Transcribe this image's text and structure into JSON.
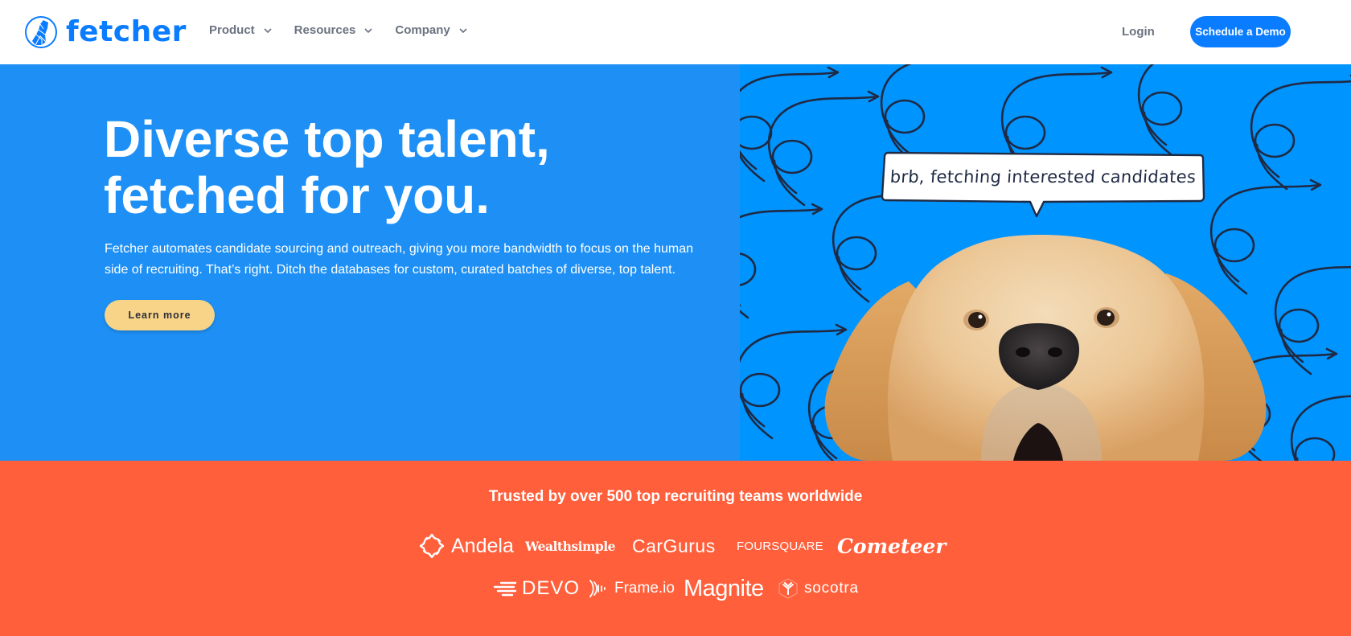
{
  "header": {
    "brand": "fetcher",
    "nav": [
      {
        "label": "Product",
        "icon": "chevron-down-icon"
      },
      {
        "label": "Resources",
        "icon": "chevron-down-icon"
      },
      {
        "label": "Company",
        "icon": "chevron-down-icon"
      }
    ],
    "login_label": "Login",
    "demo_label": "Schedule a Demo"
  },
  "hero": {
    "title_line1": "Diverse top talent,",
    "title_line2": "fetched for you.",
    "description": "Fetcher automates candidate sourcing and outreach, giving you more bandwidth to focus on the human side of recruiting. That’s right. Ditch the databases for custom, curated batches of diverse, top talent.",
    "cta_label": "Learn more",
    "speech_bubble": "brb, fetching interested candidates",
    "image": "golden-retriever-peeking"
  },
  "trusted": {
    "title": "Trusted by over 500 top recruiting teams worldwide",
    "logos_row1": [
      "Andela",
      "Wealthsimple",
      "CarGurus",
      "FOURSQUARE",
      "Cometeer"
    ],
    "logos_row2": [
      "DEVO",
      "Frame.io",
      "Magnite",
      "socotra"
    ]
  },
  "colors": {
    "brand_blue": "#0a7cff",
    "hero_blue": "#1e90f5",
    "image_blue": "#0094fe",
    "cta_yellow": "#f7d487",
    "trusted_orange": "#ff5f3b",
    "nav_gray": "#6b7280"
  }
}
